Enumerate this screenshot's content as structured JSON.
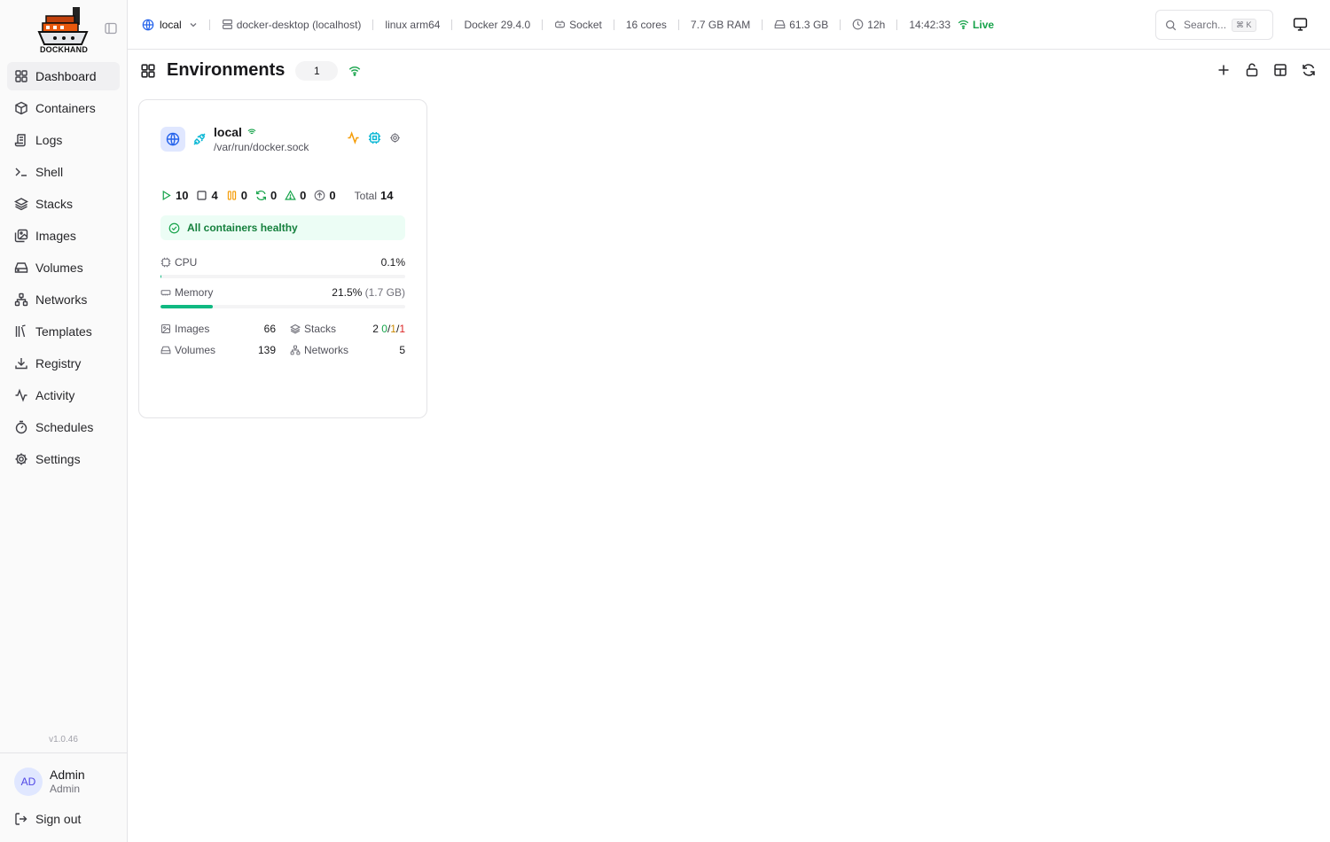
{
  "app": {
    "logo_text": "DOCKHAND",
    "version": "v1.0.46"
  },
  "sidebar": {
    "items": [
      {
        "label": "Dashboard",
        "icon": "layout-grid-icon",
        "active": true
      },
      {
        "label": "Containers",
        "icon": "box-icon"
      },
      {
        "label": "Logs",
        "icon": "scroll-icon"
      },
      {
        "label": "Shell",
        "icon": "terminal-icon"
      },
      {
        "label": "Stacks",
        "icon": "layers-icon"
      },
      {
        "label": "Images",
        "icon": "images-icon"
      },
      {
        "label": "Volumes",
        "icon": "hard-drive-icon"
      },
      {
        "label": "Networks",
        "icon": "network-icon"
      },
      {
        "label": "Templates",
        "icon": "library-icon"
      },
      {
        "label": "Registry",
        "icon": "download-icon"
      },
      {
        "label": "Activity",
        "icon": "activity-icon"
      },
      {
        "label": "Schedules",
        "icon": "timer-icon"
      },
      {
        "label": "Settings",
        "icon": "gear-icon"
      }
    ],
    "user": {
      "initials": "AD",
      "name": "Admin",
      "role": "Admin"
    },
    "sign_out": "Sign out"
  },
  "topbar": {
    "environment": "local",
    "host": "docker-desktop (localhost)",
    "platform": "linux arm64",
    "docker_version": "Docker 29.4.0",
    "connection": "Socket",
    "cores": "16 cores",
    "ram": "7.7 GB RAM",
    "disk": "61.3 GB",
    "uptime": "12h",
    "time": "14:42:33",
    "live": "Live",
    "search_placeholder": "Search...",
    "search_shortcut": "⌘ K"
  },
  "page": {
    "title": "Environments",
    "count": "1"
  },
  "card": {
    "name": "local",
    "path": "/var/run/docker.sock",
    "stats": {
      "running": "10",
      "stopped": "4",
      "paused": "0",
      "restarting": "0",
      "unhealthy": "0",
      "pending": "0",
      "total_label": "Total",
      "total": "14"
    },
    "health": "All containers healthy",
    "cpu": {
      "label": "CPU",
      "value": "0.1%",
      "percent": 0.1
    },
    "memory": {
      "label": "Memory",
      "value": "21.5%",
      "detail": "(1.7 GB)",
      "percent": 21.5
    },
    "resources": {
      "images_label": "Images",
      "images": "66",
      "stacks_label": "Stacks",
      "stacks_total": "2",
      "stacks_running": "0",
      "stacks_partial": "1",
      "stacks_stopped": "1",
      "volumes_label": "Volumes",
      "volumes": "139",
      "networks_label": "Networks",
      "networks": "5"
    }
  },
  "colors": {
    "accent": "#2563eb",
    "success": "#16a34a",
    "warning": "#f59e0b",
    "cyan": "#06b6d4",
    "danger": "#dc2626"
  }
}
